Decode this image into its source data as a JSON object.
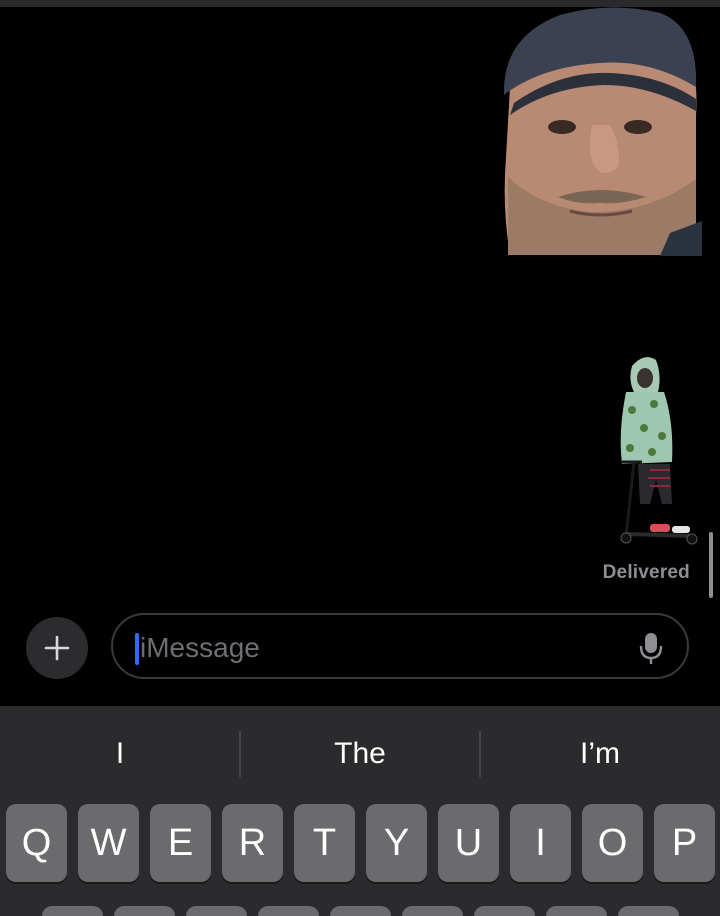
{
  "conversation": {
    "stickers": [
      {
        "name": "face-sticker"
      },
      {
        "name": "scooter-sticker"
      }
    ],
    "status": "Delivered"
  },
  "compose": {
    "placeholder": "iMessage",
    "plus_icon": "plus-icon",
    "mic_icon": "microphone-icon"
  },
  "keyboard": {
    "predictions": [
      "I",
      "The",
      "I’m"
    ],
    "top_row": [
      "Q",
      "W",
      "E",
      "R",
      "T",
      "Y",
      "U",
      "I",
      "O",
      "P"
    ]
  },
  "colors": {
    "background": "#000000",
    "caret": "#2f6bff",
    "key": "#6b6b6e",
    "keyboard": "#2b2b2d",
    "status": "#8e8e93"
  }
}
